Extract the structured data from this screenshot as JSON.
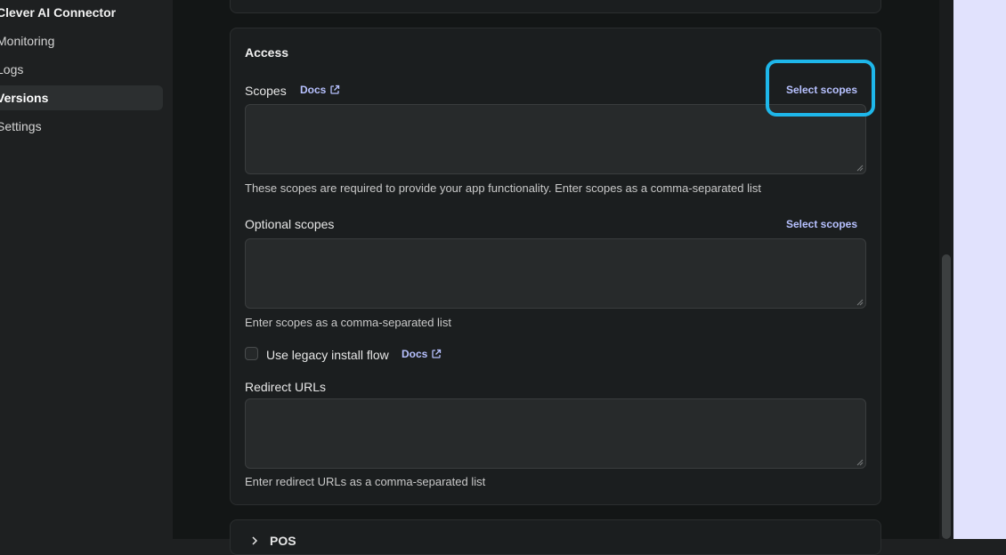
{
  "sidebar": {
    "app_name": "Clever AI Connector",
    "items": [
      {
        "label": "Monitoring",
        "active": false
      },
      {
        "label": "Logs",
        "active": false
      },
      {
        "label": "Versions",
        "active": true
      },
      {
        "label": "Settings",
        "active": false
      }
    ]
  },
  "access": {
    "title": "Access",
    "scopes": {
      "label": "Scopes",
      "docs_label": "Docs",
      "select_label": "Select scopes",
      "value": "",
      "help": "These scopes are required to provide your app functionality. Enter scopes as a comma-separated list"
    },
    "optional_scopes": {
      "label": "Optional scopes",
      "select_label": "Select scopes",
      "value": "",
      "help": "Enter scopes as a comma-separated list"
    },
    "legacy_install": {
      "label": "Use legacy install flow",
      "docs_label": "Docs",
      "checked": false
    },
    "redirect_urls": {
      "label": "Redirect URLs",
      "value": "",
      "help": "Enter redirect URLs as a comma-separated list"
    }
  },
  "bottom_section": {
    "title": "POS"
  },
  "colors": {
    "accent_link": "#b7c1ff",
    "highlight": "#1eb7ea",
    "right_pane": "#e1e2fd"
  }
}
